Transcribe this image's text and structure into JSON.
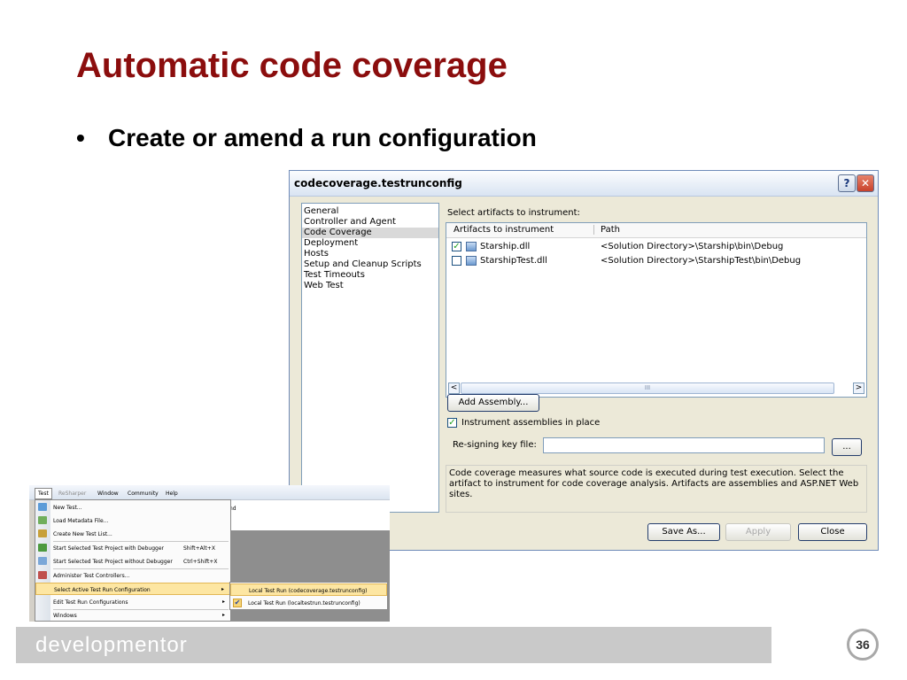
{
  "slide": {
    "title": "Automatic code coverage",
    "bullet": "•",
    "bullet_text": "Create or amend a run configuration",
    "footer_brand": "developmentor",
    "page_number": "36"
  },
  "dialog": {
    "title": "codecoverage.testrunconfig",
    "help_glyph": "?",
    "close_glyph": "✕",
    "categories": [
      "General",
      "Controller and Agent",
      "Code Coverage",
      "Deployment",
      "Hosts",
      "Setup and Cleanup Scripts",
      "Test Timeouts",
      "Web Test"
    ],
    "selected_category": "Code Coverage",
    "select_label": "Select artifacts to instrument:",
    "columns": [
      "Artifacts to instrument",
      "Path"
    ],
    "artifacts": [
      {
        "name": "Starship.dll",
        "path": "<Solution Directory>\\Starship\\bin\\Debug",
        "checked": true
      },
      {
        "name": "StarshipTest.dll",
        "path": "<Solution Directory>\\StarshipTest\\bin\\Debug",
        "checked": false
      }
    ],
    "scroll_left": "<",
    "scroll_right": ">",
    "scroll_grip": "III",
    "add_assembly": "Add Assembly...",
    "instrument_in_place": "Instrument assemblies in place",
    "instrument_checked": true,
    "resign_label": "Re-signing key file:",
    "resign_value": "",
    "browse": "...",
    "description": "Code coverage measures what source code is executed during test execution. Select the artifact to instrument for code coverage analysis. Artifacts are assemblies and ASP.NET Web sites.",
    "buttons": {
      "save_as": "Save As...",
      "apply": "Apply",
      "close": "Close"
    }
  },
  "menu_shot": {
    "menubar": [
      "Test",
      "ReSharper",
      "Window",
      "Community",
      "Help"
    ],
    "bg_text": "nd",
    "items": [
      {
        "label": "New Test...",
        "shortcut": "",
        "icon_color": "#5a9bd8"
      },
      {
        "label": "Load Metadata File...",
        "shortcut": "",
        "icon_color": "#6fae5c"
      },
      {
        "label": "Create New Test List...",
        "shortcut": "",
        "icon_color": "#c7a03a"
      },
      {
        "label": "Start Selected Test Project with Debugger",
        "shortcut": "Shift+Alt+X",
        "icon_color": "#4c9a3f"
      },
      {
        "label": "Start Selected Test Project without Debugger",
        "shortcut": "Ctrl+Shift+X",
        "icon_color": "#7aa7d8"
      },
      {
        "label": "Administer Test Controllers...",
        "shortcut": "",
        "icon_color": "#c0504d"
      },
      {
        "label": "Select Active Test Run Configuration",
        "shortcut": "",
        "arrow": "▸"
      },
      {
        "label": "Edit Test Run Configurations",
        "shortcut": "",
        "arrow": "▸"
      },
      {
        "label": "Windows",
        "shortcut": "",
        "arrow": "▸"
      }
    ],
    "submenu": [
      {
        "label": "Local Test Run (codecoverage.testrunconfig)"
      },
      {
        "label": "Local Test Run (localtestrun.testrunconfig)",
        "check": "✔"
      }
    ]
  }
}
